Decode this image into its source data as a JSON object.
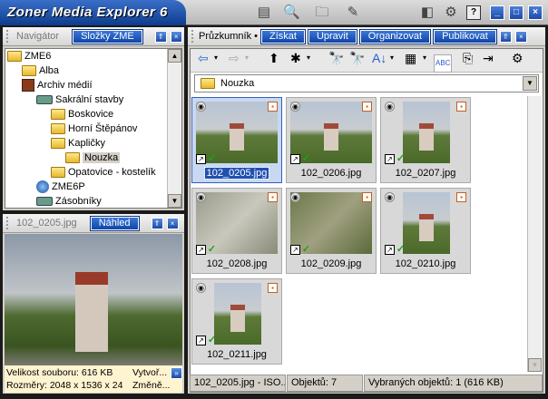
{
  "app": {
    "title": "Zoner Media Explorer 6"
  },
  "toolbar_icons": [
    "layout-icon",
    "preview-icon",
    "folders-icon",
    "edit-icon"
  ],
  "window_icons": [
    "panels-icon",
    "gear-icon",
    "help-icon",
    "minimize-icon",
    "maximize-icon",
    "close-icon"
  ],
  "navigator": {
    "title": "Navigátor",
    "tab": "Složky ZME",
    "tree": [
      {
        "label": "ZME6",
        "level": 0,
        "icon": "folder"
      },
      {
        "label": "Alba",
        "level": 1,
        "icon": "folder"
      },
      {
        "label": "Archiv médií",
        "level": 1,
        "icon": "archive"
      },
      {
        "label": "Sakrální stavby",
        "level": 2,
        "icon": "disk"
      },
      {
        "label": "Boskovice",
        "level": 3,
        "icon": "folder"
      },
      {
        "label": "Horní Štěpánov",
        "level": 3,
        "icon": "folder"
      },
      {
        "label": "Kapličky",
        "level": 3,
        "icon": "folder"
      },
      {
        "label": "Nouzka",
        "level": 4,
        "icon": "folder",
        "selected": true
      },
      {
        "label": "Opatovice - kostelík",
        "level": 3,
        "icon": "folder"
      },
      {
        "label": "ZME6P",
        "level": 2,
        "icon": "globe"
      },
      {
        "label": "Zásobníky",
        "level": 2,
        "icon": "disk"
      }
    ]
  },
  "preview": {
    "title": "102_0205.jpg",
    "tab": "Náhled",
    "info": {
      "size": "Velikost souboru: 616 KB",
      "created": "Vytvoř...",
      "dims": "Rozměry: 2048 x 1536 x 24",
      "modified": "Změně..."
    }
  },
  "explorer": {
    "title": "Průzkumník •",
    "tabs": [
      "Získat",
      "Upravit",
      "Organizovat",
      "Publikovat"
    ],
    "path": "Nouzka",
    "thumbs": [
      {
        "name": "102_0205.jpg",
        "orient": "h",
        "selected": true
      },
      {
        "name": "102_0206.jpg",
        "orient": "h"
      },
      {
        "name": "102_0207.jpg",
        "orient": "v"
      },
      {
        "name": "102_0208.jpg",
        "orient": "g"
      },
      {
        "name": "102_0209.jpg",
        "orient": "gr"
      },
      {
        "name": "102_0210.jpg",
        "orient": "v"
      },
      {
        "name": "102_0211.jpg",
        "orient": "v"
      }
    ],
    "status": {
      "file": "102_0205.jpg - ISO...",
      "count": "Objektů: 7",
      "selected": "Vybraných objektů: 1 (616 KB)"
    }
  }
}
